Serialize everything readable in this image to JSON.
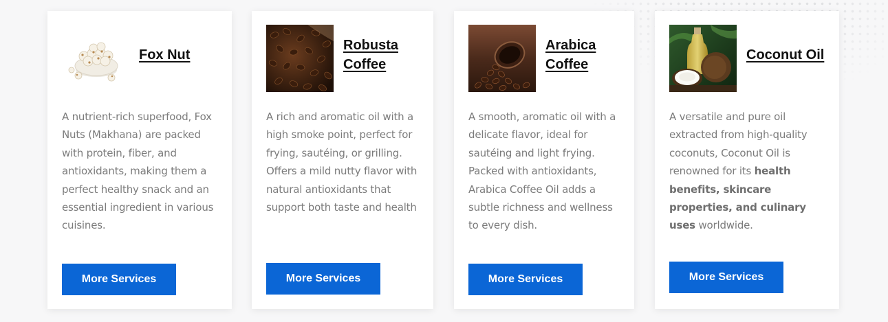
{
  "cards": [
    {
      "title_line1": "Fox Nut",
      "title_line2": "",
      "image": "fox-nut-bowl-image",
      "description": "A nutrient-rich superfood, Fox Nuts (Makhana) are packed with protein, fiber, and antioxidants, making them a perfect healthy snack and an essential ingredient in various cuisines.",
      "button": "More Services"
    },
    {
      "title_line1": "Robusta",
      "title_line2": "Coffee",
      "image": "robusta-coffee-beans-image",
      "description": "A rich and aromatic oil with a high smoke point, perfect for frying, sautéing, or grilling. Offers a mild nutty flavor with natural antioxidants that support both taste and health",
      "button": "More Services"
    },
    {
      "title_line1": "Arabica",
      "title_line2": "Coffee",
      "image": "arabica-coffee-cup-image",
      "description": "A smooth, aromatic oil with a delicate flavor, ideal for sautéing and light frying. Packed with antioxidants, Arabica Coffee Oil adds a subtle richness and wellness to every dish.",
      "button": "More Services"
    },
    {
      "title_line1": "Coconut Oil",
      "title_line2": "",
      "image": "coconut-oil-bottle-image",
      "description_pre": "A versatile and pure oil extracted from high-quality coconuts, Coconut Oil is renowned for its ",
      "description_bold": "health benefits, skincare properties, and culinary uses",
      "description_post": " worldwide.",
      "button": "More Services"
    }
  ],
  "colors": {
    "button_bg": "#0b66d6",
    "button_text": "#ffffff",
    "title_text": "#111111",
    "body_text": "#7c7c7c",
    "card_bg": "#ffffff",
    "page_bg": "#f7f7f8"
  }
}
